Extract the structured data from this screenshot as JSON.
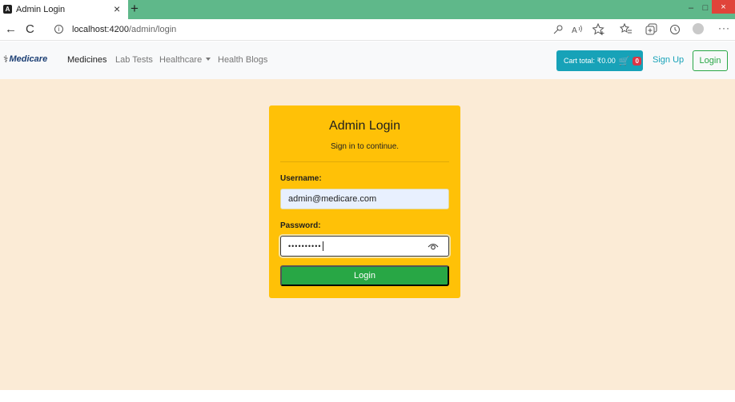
{
  "browser": {
    "tab_title": "Admin Login",
    "tab_favicon": "A",
    "tab_close": "×",
    "new_tab": "+",
    "url_host": "localhost:4200",
    "url_path": "/admin/login",
    "window": {
      "min": "–",
      "max": "□",
      "close": "×"
    },
    "icons": [
      "back-icon",
      "refresh-icon",
      "info-icon",
      "key-icon",
      "read-aloud-icon",
      "favorite-add-icon",
      "favorites-icon",
      "collections-icon",
      "history-icon",
      "profile-icon",
      "more-icon"
    ],
    "glyphs": {
      "back": "←",
      "refresh": "C",
      "info": "i",
      "more": "···"
    }
  },
  "navbar": {
    "brand": "Medicare",
    "links": [
      "Medicines",
      "Lab Tests",
      "Healthcare",
      "Health Blogs"
    ],
    "active_link": "Medicines",
    "cart_label": "Cart total: ₹0.00",
    "cart_icon": "🛒",
    "cart_count": "0",
    "signup": "Sign Up",
    "login": "Login",
    "colors": {
      "cart": "#17a2b8",
      "badge": "#dc3545",
      "login": "#28a745"
    }
  },
  "login_card": {
    "title": "Admin Login",
    "subtitle": "Sign in to continue.",
    "username_label": "Username:",
    "username_value": "admin@medicare.com",
    "password_label": "Password:",
    "password_value": "••••••••••",
    "submit": "Login",
    "colors": {
      "card": "#ffc107",
      "button": "#28a745",
      "page": "#fbebd6"
    }
  }
}
